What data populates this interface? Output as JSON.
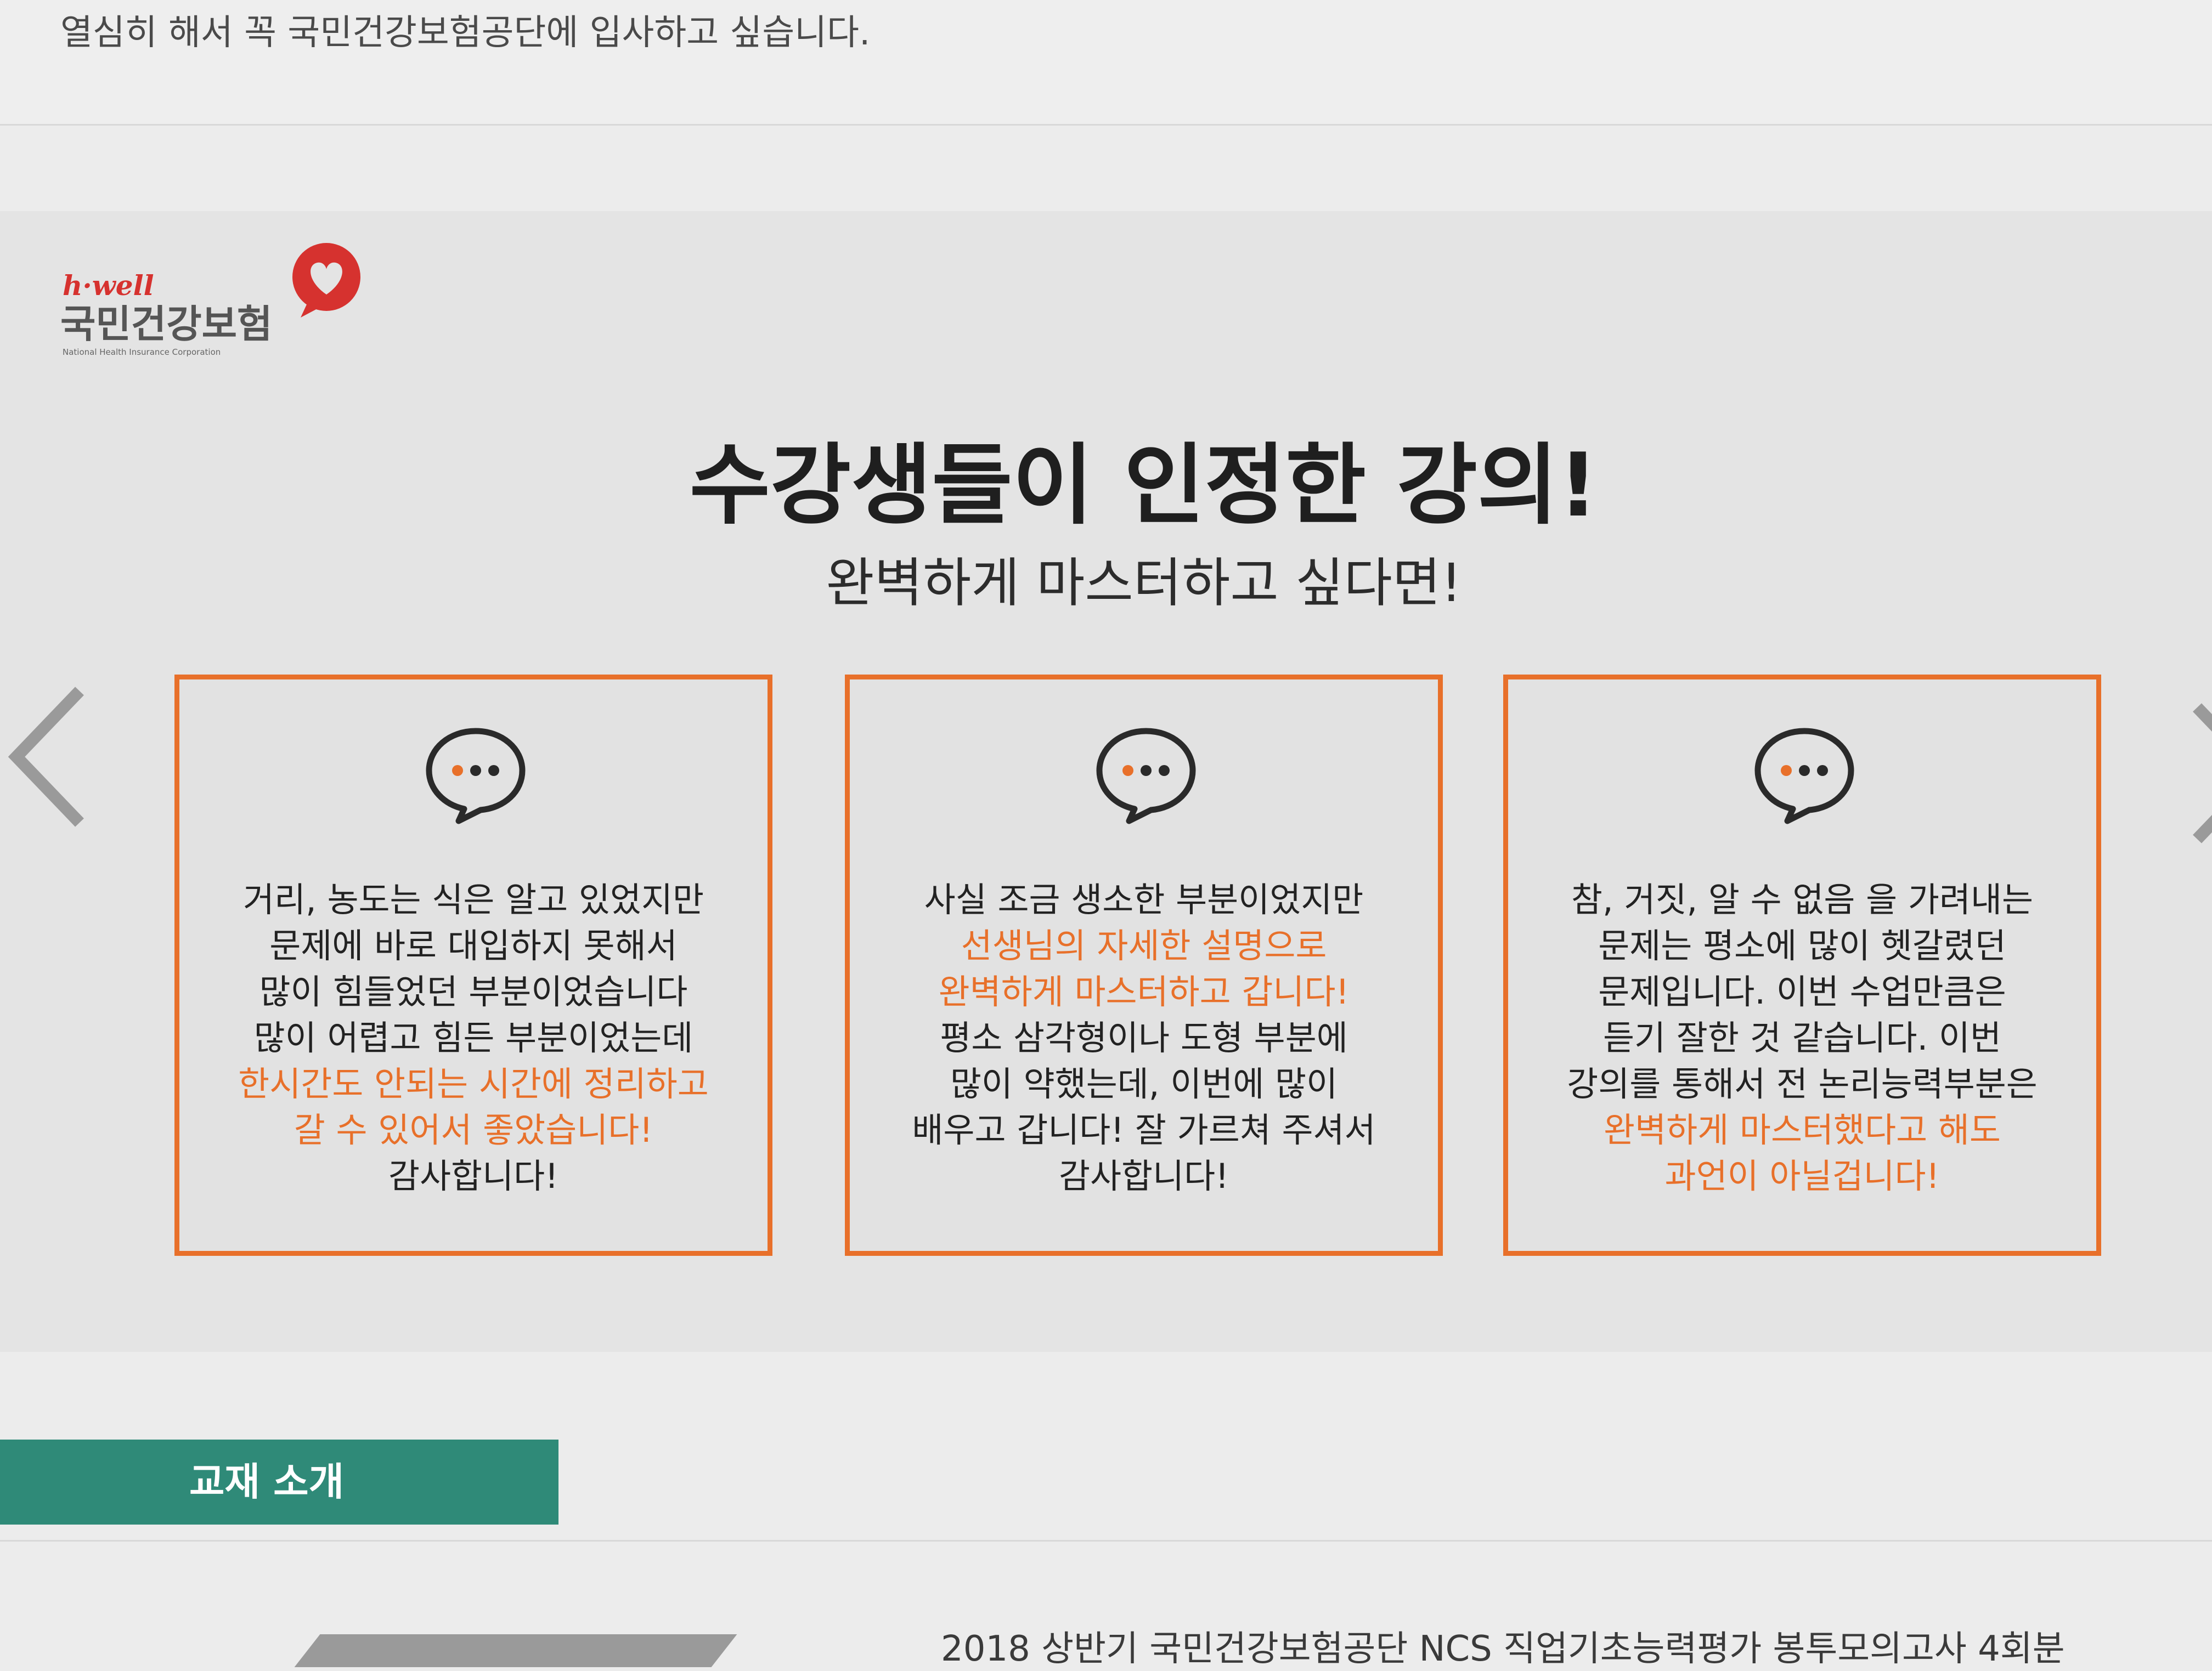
{
  "top_review": {
    "text": "열심히 해서 꼭 국민건강보험공단에 입사하고 싶습니다."
  },
  "logo": {
    "english": "h·well",
    "korean": "국민건강보험",
    "subtitle": "National Health Insurance Corporation"
  },
  "section": {
    "title": "수강생들이 인정한 강의!",
    "subtitle": "완벽하게 마스터하고 싶다면!"
  },
  "reviews": [
    {
      "lines": [
        "거리, 농도는 식은 알고 있었지만",
        "문제에 바로 대입하지 못해서",
        "많이 힘들었던 부분이었습니다",
        "많이 어렵고 힘든 부분이었는데"
      ],
      "highlight": [
        "한시간도 안되는 시간에 정리하고",
        "갈 수 있어서 좋았습니다!"
      ],
      "after": [
        "감사합니다!"
      ]
    },
    {
      "before": [
        "사실 조금 생소한 부분이었지만"
      ],
      "highlight": [
        "선생님의 자세한 설명으로",
        "완벽하게 마스터하고 갑니다!"
      ],
      "after": [
        "평소 삼각형이나 도형 부분에",
        "많이 약했는데, 이번에 많이",
        "배우고 갑니다! 잘 가르쳐 주셔서",
        "감사합니다!"
      ]
    },
    {
      "lines": [
        "참, 거짓, 알 수 없음 을 가려내는",
        "문제는 평소에 많이 헷갈렸던",
        "문제입니다. 이번 수업만큼은",
        "듣기 잘한 것 같습니다. 이번",
        "강의를 통해서 전 논리능력부분은"
      ],
      "highlight": [
        "완벽하게 마스터했다고 해도",
        "과언이 아닐겁니다!"
      ]
    }
  ],
  "book_section": {
    "tab_label": "교재 소개",
    "book_title": "2018 상반기 국민건강보험공단 NCS 직업기초능력평가 봉투모의고사 4회분"
  },
  "colors": {
    "accent_orange": "#e8702a",
    "teal_tab": "#2f8a78",
    "logo_red": "#d6322f"
  },
  "icons": {
    "card_icon": "speech-bubble-icon",
    "prev": "chevron-left-icon",
    "next": "chevron-right-icon"
  }
}
